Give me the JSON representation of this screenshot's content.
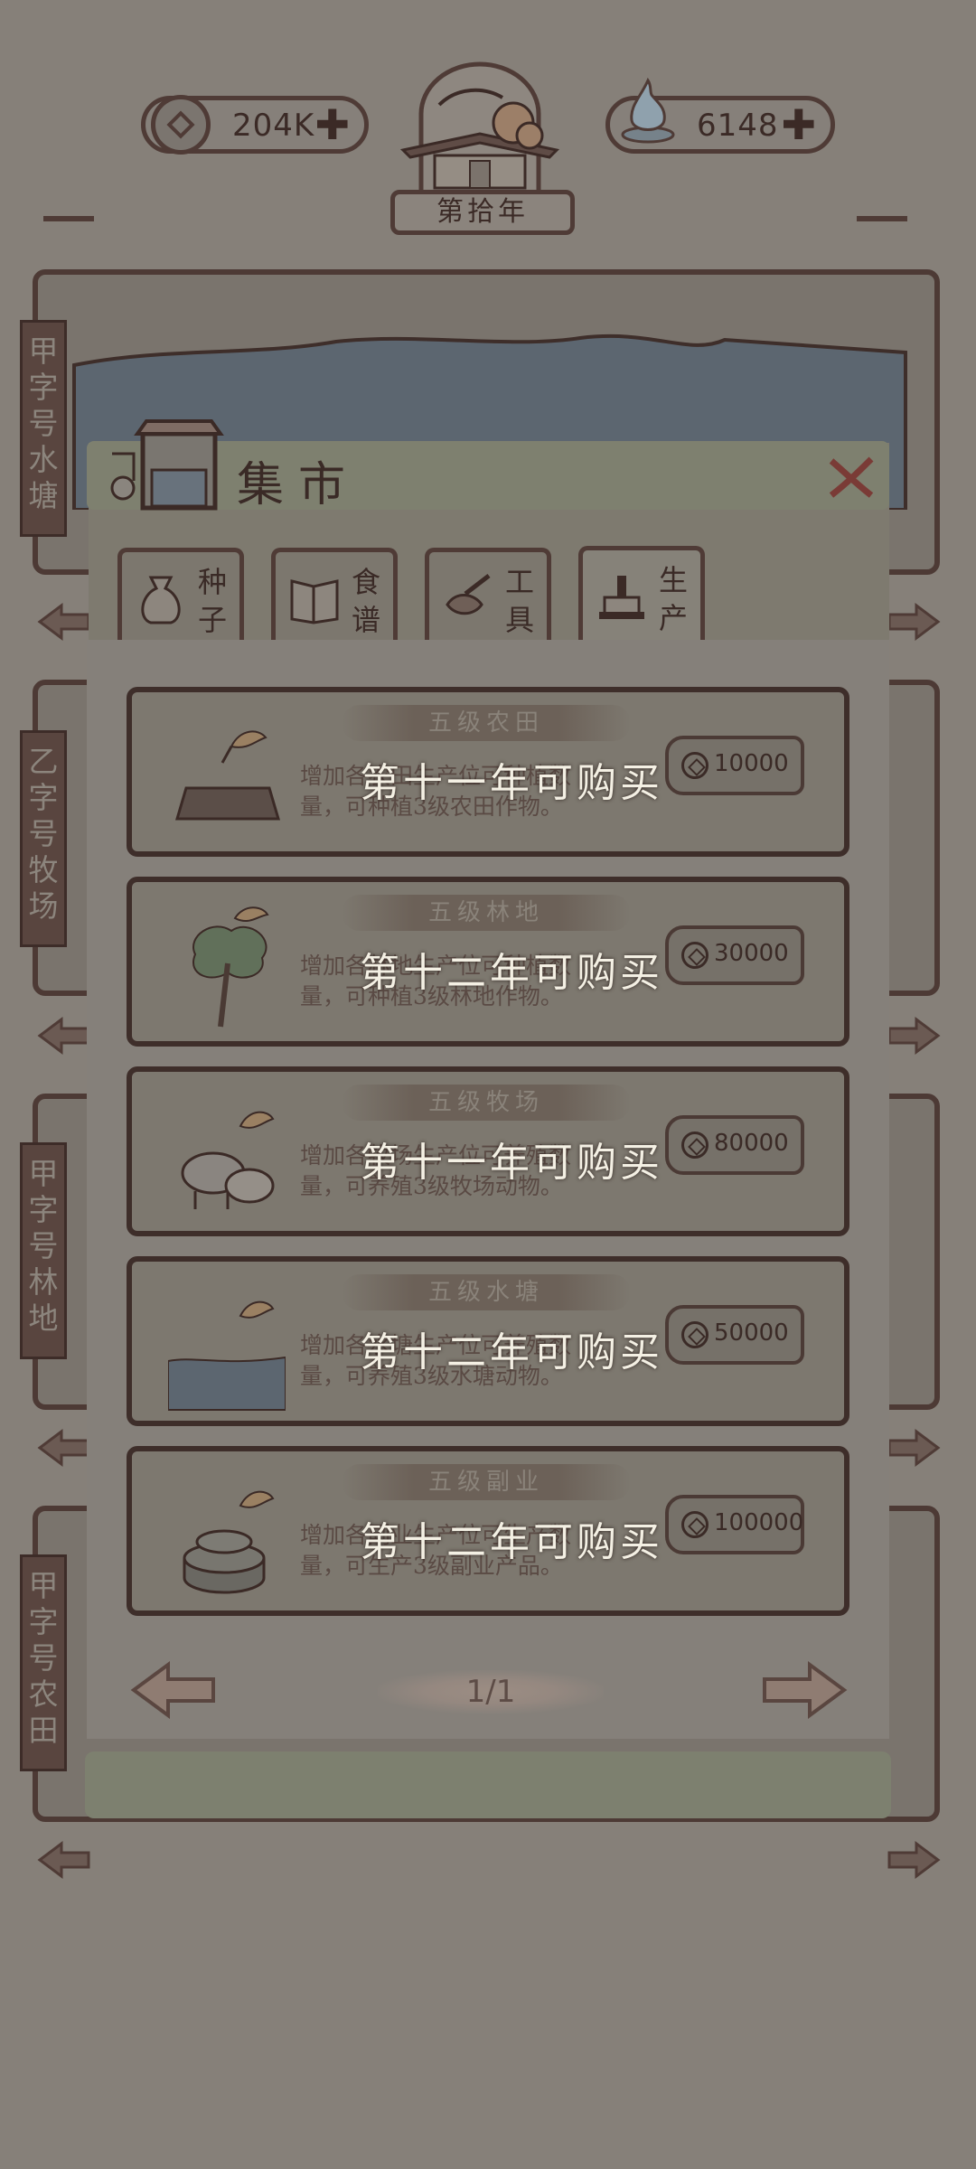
{
  "topbar": {
    "coins": "204K",
    "water": "6148",
    "year_label": "第拾年",
    "plus": "✚"
  },
  "side_labels": [
    "甲字号水塘",
    "乙字号牧场",
    "甲字号林地",
    "甲字号农田"
  ],
  "modal": {
    "title": "集市",
    "tabs": [
      {
        "l1": "种",
        "l2": "子"
      },
      {
        "l1": "食",
        "l2": "谱"
      },
      {
        "l1": "工",
        "l2": "具"
      },
      {
        "l1": "生",
        "l2": "产"
      }
    ],
    "active_tab": 3,
    "items": [
      {
        "name": "五级农田",
        "desc1": "增加各农田生产位可种植数",
        "desc2": "量，可种植3级农田作物。",
        "lock": "第十一年可购买",
        "price": "10000",
        "icon": "field-icon"
      },
      {
        "name": "五级林地",
        "desc1": "增加各林地生产位可种植数",
        "desc2": "量，可种植3级林地作物。",
        "lock": "第十二年可购买",
        "price": "30000",
        "icon": "tree-icon"
      },
      {
        "name": "五级牧场",
        "desc1": "增加各牧场生产位可养殖数",
        "desc2": "量，可养殖3级牧场动物。",
        "lock": "第十一年可购买",
        "price": "80000",
        "icon": "livestock-icon"
      },
      {
        "name": "五级水塘",
        "desc1": "增加各水塘生产位可养殖数",
        "desc2": "量，可养殖3级水塘动物。",
        "lock": "第十二年可购买",
        "price": "50000",
        "icon": "pond-icon"
      },
      {
        "name": "五级副业",
        "desc1": "增加各副业生产位可生产数",
        "desc2": "量，可生产3级副业产品。",
        "lock": "第十二年可购买",
        "price": "100000",
        "icon": "millstone-icon"
      }
    ],
    "page": "1/1"
  }
}
